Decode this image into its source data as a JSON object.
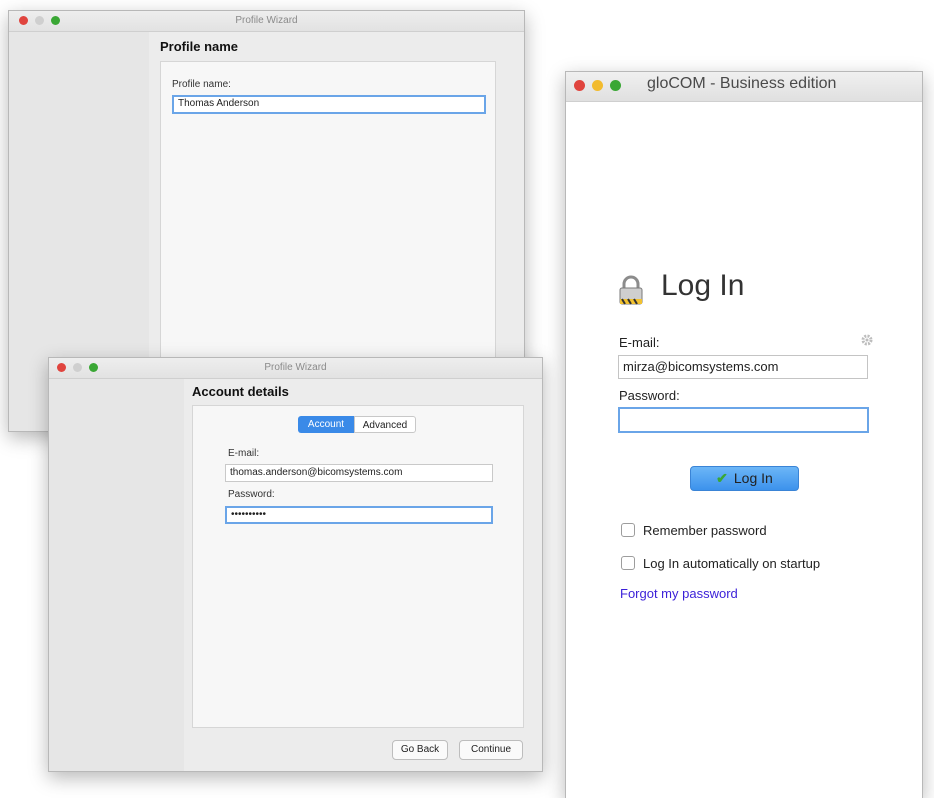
{
  "wizard1": {
    "title": "Profile Wizard",
    "section_title": "Profile name",
    "name_label": "Profile name:",
    "name_value": "Thomas Anderson"
  },
  "wizard2": {
    "title": "Profile Wizard",
    "section_title": "Account details",
    "tabs": {
      "account": "Account",
      "advanced": "Advanced"
    },
    "email_label": "E-mail:",
    "email_value": "thomas.anderson@bicomsystems.com",
    "password_label": "Password:",
    "password_value": "••••••••••",
    "go_back": "Go Back",
    "continue": "Continue"
  },
  "glocom": {
    "title": "gloCOM - Business edition",
    "login_heading": "Log In",
    "email_label": "E-mail:",
    "email_value": "mirza@bicomsystems.com",
    "password_label": "Password:",
    "password_value": "",
    "login_button": "Log In",
    "remember_label": "Remember password",
    "remember_checked": false,
    "autologin_label": "Log In automatically on startup",
    "autologin_checked": false,
    "forgot_link": "Forgot my password",
    "colors": {
      "link": "#3a1fd8",
      "accent": "#3a8ae8",
      "check": "#3aa735"
    }
  }
}
